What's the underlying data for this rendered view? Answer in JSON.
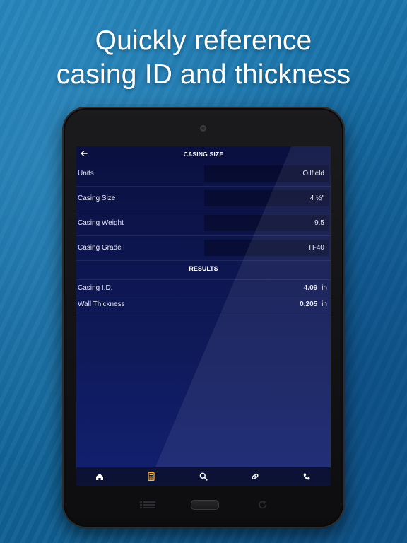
{
  "headline": {
    "line1": "Quickly reference",
    "line2": "casing ID and thickness"
  },
  "screen": {
    "title": "CASING SIZE",
    "inputs": [
      {
        "label": "Units",
        "value": "Oilfield"
      },
      {
        "label": "Casing Size",
        "value": "4 ½\""
      },
      {
        "label": "Casing Weight",
        "value": "9.5"
      },
      {
        "label": "Casing Grade",
        "value": "H-40"
      }
    ],
    "results_title": "RESULTS",
    "results": [
      {
        "label": "Casing I.D.",
        "value": "4.09",
        "unit": "in"
      },
      {
        "label": "Wall Thickness",
        "value": "0.205",
        "unit": "in"
      }
    ],
    "tabs": [
      {
        "icon": "home-icon",
        "active": false
      },
      {
        "icon": "calculator-icon",
        "active": true
      },
      {
        "icon": "search-icon",
        "active": false
      },
      {
        "icon": "link-icon",
        "active": false
      },
      {
        "icon": "phone-icon",
        "active": false
      }
    ]
  },
  "colors": {
    "accent": "#f2b233",
    "screen_bg": "#0f1a5a",
    "text": "#e6e8f5"
  }
}
